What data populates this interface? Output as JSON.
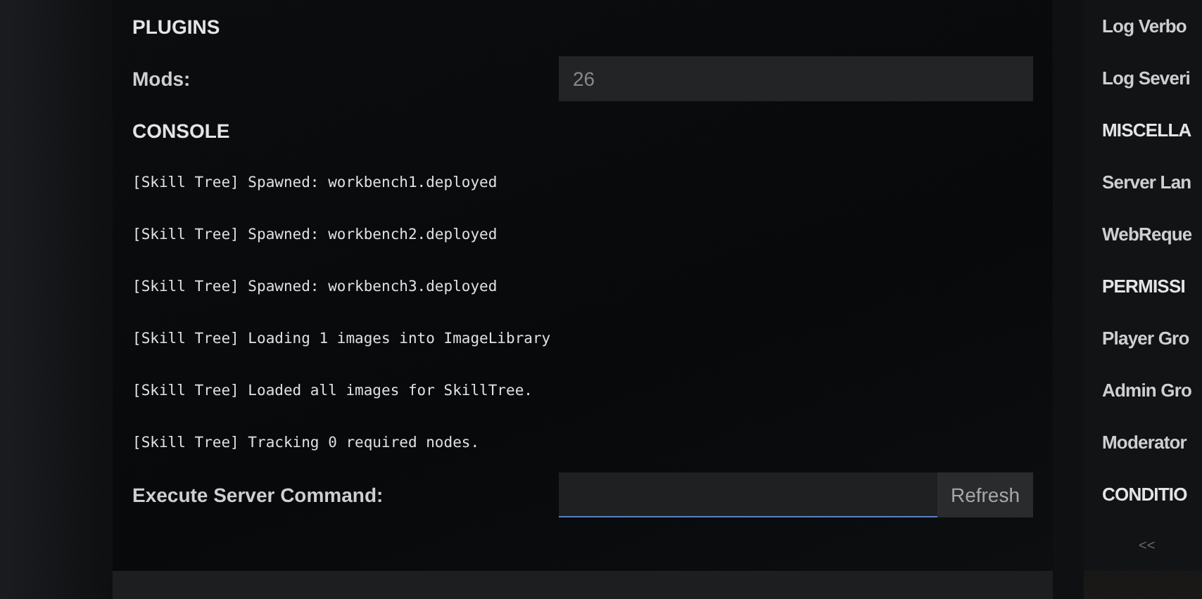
{
  "plugins": {
    "heading": "PLUGINS",
    "mods_label": "Mods:",
    "mods_value": "26"
  },
  "console": {
    "heading": "CONSOLE",
    "lines": [
      "[Skill Tree] Spawned: workbench1.deployed",
      "[Skill Tree] Spawned: workbench2.deployed",
      "[Skill Tree] Spawned: workbench3.deployed",
      "[Skill Tree] Loading 1 images into ImageLibrary",
      "[Skill Tree] Loaded all images for SkillTree.",
      "[Skill Tree] Tracking 0 required nodes."
    ],
    "command_label": "Execute Server Command:",
    "command_focused": true,
    "refresh_button": "Refresh"
  },
  "sidebar": {
    "items": [
      {
        "kind": "label",
        "text": "Log Verbo"
      },
      {
        "kind": "label",
        "text": "Log Severi"
      },
      {
        "kind": "heading",
        "text": "MISCELLA"
      },
      {
        "kind": "label",
        "text": "Server Lan"
      },
      {
        "kind": "label",
        "text": "WebReque"
      },
      {
        "kind": "heading",
        "text": "PERMISSI"
      },
      {
        "kind": "label",
        "text": "Player Gro"
      },
      {
        "kind": "label",
        "text": "Admin Gro"
      },
      {
        "kind": "label",
        "text": "Moderator"
      },
      {
        "kind": "heading",
        "text": "CONDITIO"
      }
    ],
    "collapse": "<<"
  }
}
